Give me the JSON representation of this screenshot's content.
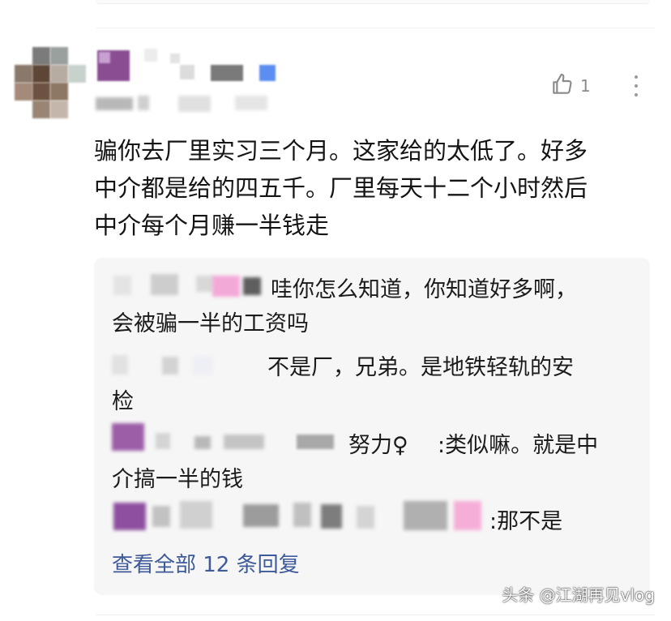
{
  "comment": {
    "text_lines": [
      "骗你去厂里实习三个月。这家给的太低了。好多",
      "中介都是给的四五千。厂里每天十二个小时然后",
      "中介每个月赚一半钱走"
    ],
    "like_count": "1",
    "like_icon": "thumbs-up-icon",
    "more_icon": "more-vertical-icon"
  },
  "replies": [
    {
      "lines": [
        "哇你怎么知道，你知道好多啊，",
        "会被骗一半的工资吗"
      ]
    },
    {
      "lines": [
        "不是厂，兄弟。是地铁轻轨的安",
        "检"
      ]
    },
    {
      "name_tail": "努力♀",
      "lines": [
        ":类似嘛。就是中",
        "介搞一半的钱"
      ]
    },
    {
      "lines": [
        ":那不是"
      ]
    }
  ],
  "view_all_replies": "查看全部 12 条回复",
  "watermark": "头条 @江湖再见vlog",
  "colors": {
    "link": "#3e5a9a",
    "panel_bg": "#f6f6f6",
    "text": "#141414",
    "muted": "#8a8a8a"
  }
}
